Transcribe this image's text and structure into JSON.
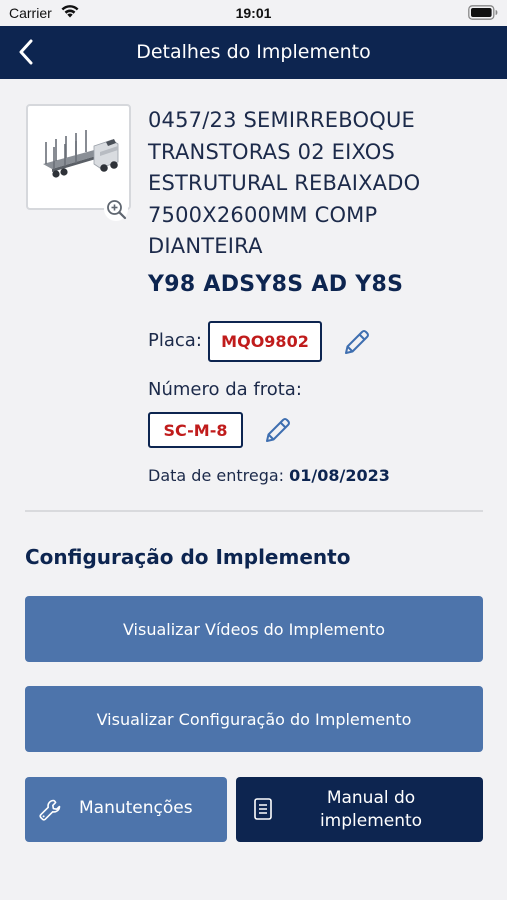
{
  "status_bar": {
    "carrier": "Carrier",
    "time": "19:01"
  },
  "nav": {
    "title": "Detalhes do Implemento"
  },
  "product": {
    "name": "0457/23 SEMIRREBOQUE TRANSTORAS 02 EIXOS ESTRUTURAL REBAIXADO 7500X2600MM COMP DIANTEIRA",
    "code": "Y98 ADSY8S AD Y8S"
  },
  "plate": {
    "label": "Placa:",
    "value": "MQO9802"
  },
  "fleet": {
    "label": "Número da frota:",
    "value": "SC-M-8"
  },
  "delivery": {
    "label": "Data de entrega:",
    "value": "01/08/2023"
  },
  "config": {
    "title": "Configuração do Implemento",
    "videos_button": "Visualizar Vídeos do Implemento",
    "config_button": "Visualizar Configuração do Implemento",
    "maintenance_button": "Manutenções",
    "manual_button": "Manual do implemento"
  },
  "colors": {
    "navy": "#0d2550",
    "button_blue": "#4d74ab",
    "plate_red": "#c01c1c",
    "edit_blue": "#3f6fb0"
  }
}
